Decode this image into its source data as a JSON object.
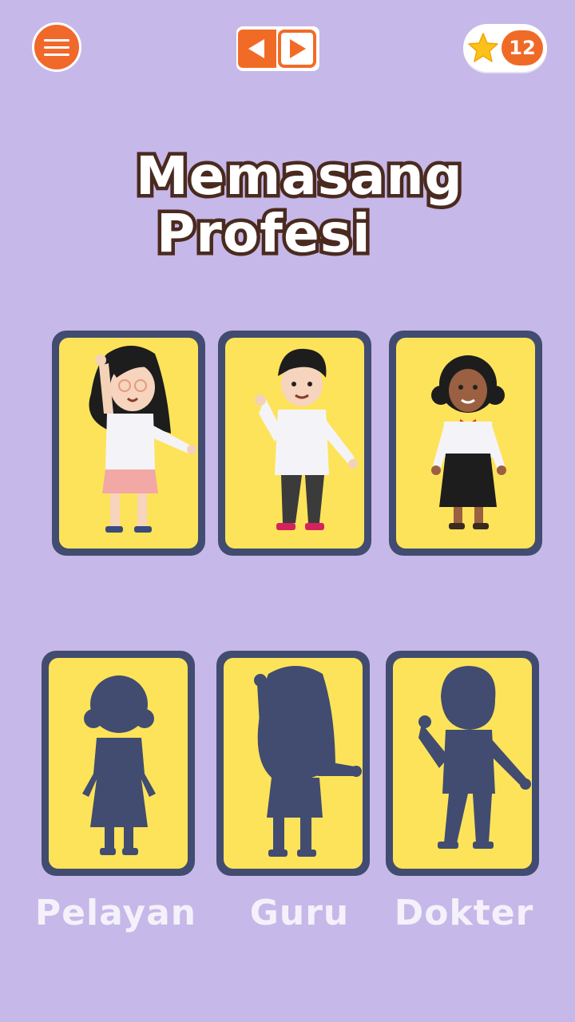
{
  "header": {
    "menu_icon": "hamburger-menu-icon",
    "prev_icon": "triangle-left-icon",
    "next_icon": "triangle-right-icon",
    "star_icon": "star-icon",
    "score": "12"
  },
  "title": {
    "line1": "Memasang",
    "line2": "Profesi"
  },
  "characters": [
    {
      "card": "character-card-1",
      "figure": "girl-with-glasses"
    },
    {
      "card": "character-card-2",
      "figure": "boy-in-white-coat"
    },
    {
      "card": "character-card-3",
      "figure": "woman-in-black-skirt"
    }
  ],
  "targets": [
    {
      "silhouette": "woman-silhouette",
      "label": "Pelayan"
    },
    {
      "silhouette": "girl-silhouette",
      "label": "Guru"
    },
    {
      "silhouette": "boy-silhouette",
      "label": "Dokter"
    }
  ],
  "colors": {
    "background": "#c6b8e8",
    "accent": "#f26b26",
    "card_frame": "#414c70",
    "card_fill": "#fde35a",
    "title_outline": "#4a2a1f"
  }
}
